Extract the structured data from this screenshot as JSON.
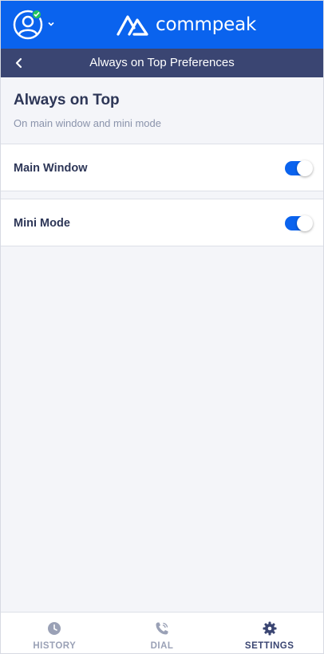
{
  "header": {
    "logo_text": "commpeak",
    "avatar_icon": "user-avatar-icon",
    "status": "online",
    "colors": {
      "primary": "#0a63ee",
      "status_online": "#22c55e"
    }
  },
  "subheader": {
    "title": "Always on Top Preferences",
    "back_icon": "chevron-left-icon",
    "color": "#3a4572"
  },
  "section": {
    "title": "Always on Top",
    "subtitle": "On main window and mini mode"
  },
  "settings": [
    {
      "label": "Main Window",
      "enabled": true
    },
    {
      "label": "Mini Mode",
      "enabled": true
    }
  ],
  "bottom_nav": {
    "items": [
      {
        "label": "HISTORY",
        "icon": "clock-icon",
        "active": false
      },
      {
        "label": "DIAL",
        "icon": "phone-icon",
        "active": false
      },
      {
        "label": "SETTINGS",
        "icon": "gear-icon",
        "active": true
      }
    ]
  }
}
